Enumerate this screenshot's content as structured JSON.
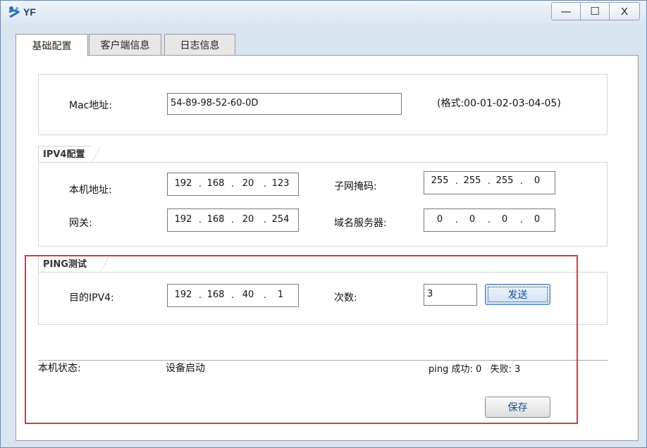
{
  "window": {
    "title": "YF",
    "icon": "yf-app-icon",
    "controls": {
      "minimize": "—",
      "maximize": "☐",
      "close": "X"
    }
  },
  "tabs": [
    {
      "label": "基础配置",
      "active": true
    },
    {
      "label": "客户端信息",
      "active": false
    },
    {
      "label": "日志信息",
      "active": false
    }
  ],
  "mac": {
    "label": "Mac地址:",
    "value": "54-89-98-52-60-0D",
    "format_hint": "(格式:00-01-02-03-04-05)"
  },
  "ipv4": {
    "group_title": "IPV4配置",
    "local_address": {
      "label": "本机地址:",
      "octets": [
        "192",
        "168",
        "20",
        "123"
      ]
    },
    "subnet_mask": {
      "label": "子网掩码:",
      "octets": [
        "255",
        "255",
        "255",
        "0"
      ]
    },
    "gateway": {
      "label": "网关:",
      "octets": [
        "192",
        "168",
        "20",
        "254"
      ]
    },
    "dns": {
      "label": "域名服务器:",
      "octets": [
        "0",
        "0",
        "0",
        "0"
      ]
    }
  },
  "ping": {
    "group_title": "PING测试",
    "target": {
      "label": "目的IPV4:",
      "octets": [
        "192",
        "168",
        "40",
        "1"
      ]
    },
    "count": {
      "label": "次数:",
      "value": "3"
    },
    "send_label": "发送"
  },
  "status": {
    "label": "本机状态:",
    "value": "设备启动",
    "ping_summary": "ping 成功: 0   失败: 3"
  },
  "save_label": "保存",
  "colors": {
    "highlight": "#e0383e",
    "accent": "#1a4f9c"
  }
}
